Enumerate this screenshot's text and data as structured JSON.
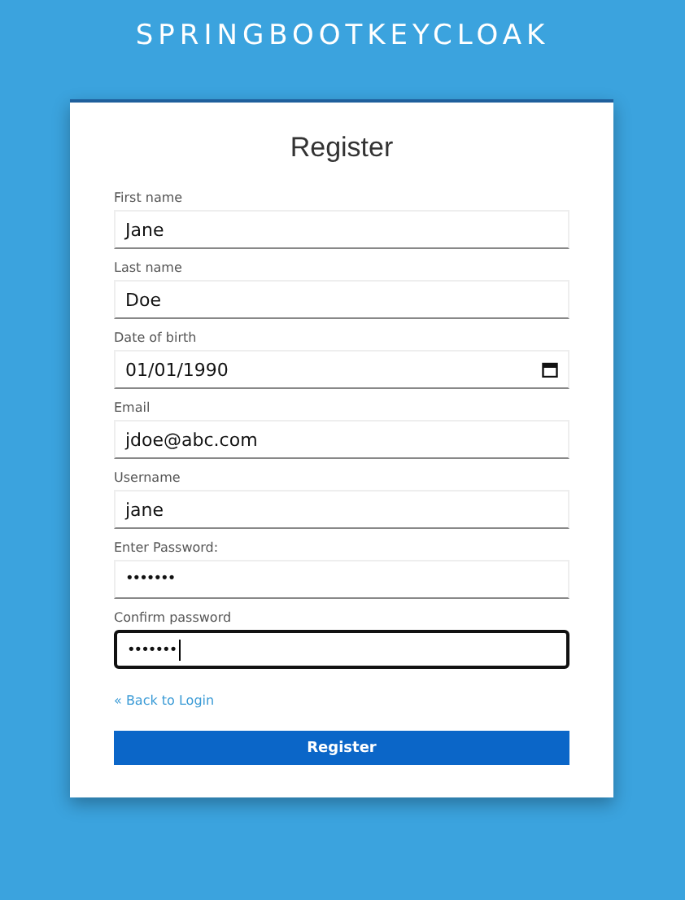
{
  "header": {
    "title": "SPRINGBOOTKEYCLOAK"
  },
  "form": {
    "title": "Register",
    "fields": [
      {
        "label": "First name",
        "kind": "text",
        "value": "Jane",
        "focused": false
      },
      {
        "label": "Last name",
        "kind": "text",
        "value": "Doe",
        "focused": false
      },
      {
        "label": "Date of birth",
        "kind": "date",
        "value": "01/01/1990",
        "focused": false
      },
      {
        "label": "Email",
        "kind": "text",
        "value": "jdoe@abc.com",
        "focused": false
      },
      {
        "label": "Username",
        "kind": "text",
        "value": "jane",
        "focused": false
      },
      {
        "label": "Enter Password:",
        "kind": "password",
        "value": "•••••••",
        "focused": false
      },
      {
        "label": "Confirm password",
        "kind": "password",
        "value": "•••••••",
        "focused": true
      }
    ],
    "back_link": "« Back to Login",
    "submit_button": "Register"
  }
}
